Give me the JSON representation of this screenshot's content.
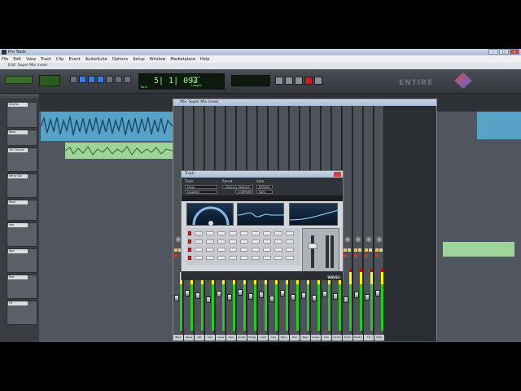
{
  "app": {
    "title": "Pro Tools"
  },
  "menu": [
    "File",
    "Edit",
    "View",
    "Track",
    "Clip",
    "Event",
    "AudioSuite",
    "Options",
    "Setup",
    "Window",
    "Marketplace",
    "Help"
  ],
  "edit_window": {
    "title": "Edit: Super Mix (new)"
  },
  "counter": {
    "main": "5| 1| 093",
    "label": "Main",
    "sub1": "Start",
    "sub2": "End",
    "sub3": "Length"
  },
  "brand": "ENTIRE",
  "mix_window": {
    "title": "Mix: Super Mix (new)"
  },
  "plugin": {
    "title": "Track",
    "track_label": "Track",
    "preset_label": "Preset",
    "auto_label": "Auto",
    "track_name": "Drive",
    "preset_name": "<factory default>",
    "insert": "Doubled",
    "compare": "COMPARE",
    "bypass": "BYPASS",
    "safe": "Safe",
    "bar_text": "",
    "brand": "WAVES"
  },
  "strips": [
    {
      "name": "Bass"
    },
    {
      "name": "Wave"
    },
    {
      "name": "Dbl"
    },
    {
      "name": "Vox"
    },
    {
      "name": "Chrus"
    },
    {
      "name": "Verb"
    },
    {
      "name": "Guitar"
    },
    {
      "name": "Brdge"
    },
    {
      "name": "Lead"
    },
    {
      "name": "Clav"
    },
    {
      "name": "Bgvs"
    },
    {
      "name": "Pad"
    },
    {
      "name": "Bass"
    },
    {
      "name": "Snare"
    },
    {
      "name": "Kick"
    },
    {
      "name": "Ovrhd"
    },
    {
      "name": "Room"
    },
    {
      "name": "Master"
    },
    {
      "name": "FX"
    },
    {
      "name": "Main"
    }
  ],
  "tracks": [
    {
      "name": "Drums"
    },
    {
      "name": "Bass"
    },
    {
      "name": "Gtr Chorus"
    },
    {
      "name": "Verse Gtr"
    },
    {
      "name": "Keys"
    },
    {
      "name": "Vox"
    },
    {
      "name": "Bgv"
    },
    {
      "name": "Pad"
    },
    {
      "name": "FX"
    }
  ],
  "colors": {
    "region_blue": "#58a2c8",
    "region_green": "#9ed49a",
    "counter_green": "#9cff8a"
  }
}
